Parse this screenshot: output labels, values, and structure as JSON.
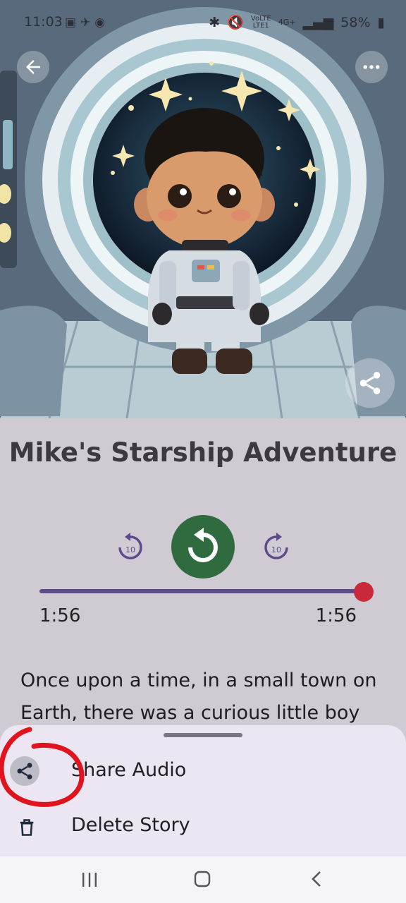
{
  "status_bar": {
    "time": "11:03",
    "battery": "58%",
    "network": "4G+",
    "network_sub": "LTE1",
    "volte": "VoLTE"
  },
  "hero": {
    "image_alt": "Illustration of a boy in a spacesuit standing in a starship",
    "icons": {
      "back": "back-arrow-icon",
      "more": "more-vert-icon",
      "share": "share-icon"
    }
  },
  "story": {
    "title": "Mike's Starship Adventure",
    "text": "Once upon a time, in a small town on Earth, there was a curious little boy"
  },
  "player": {
    "rewind_seconds": "10",
    "forward_seconds": "10",
    "elapsed": "1:56",
    "duration": "1:56",
    "progress": 1.0,
    "colors": {
      "play_button": "#2f6b3f",
      "track": "#5d4c8a",
      "thumb": "#c92a3a"
    }
  },
  "sheet": {
    "items": [
      {
        "label": "Share Audio",
        "icon": "share-icon"
      },
      {
        "label": "Delete Story",
        "icon": "trash-icon"
      }
    ]
  },
  "navbar": {
    "icons": [
      "recent-apps-icon",
      "home-icon",
      "back-icon"
    ]
  }
}
